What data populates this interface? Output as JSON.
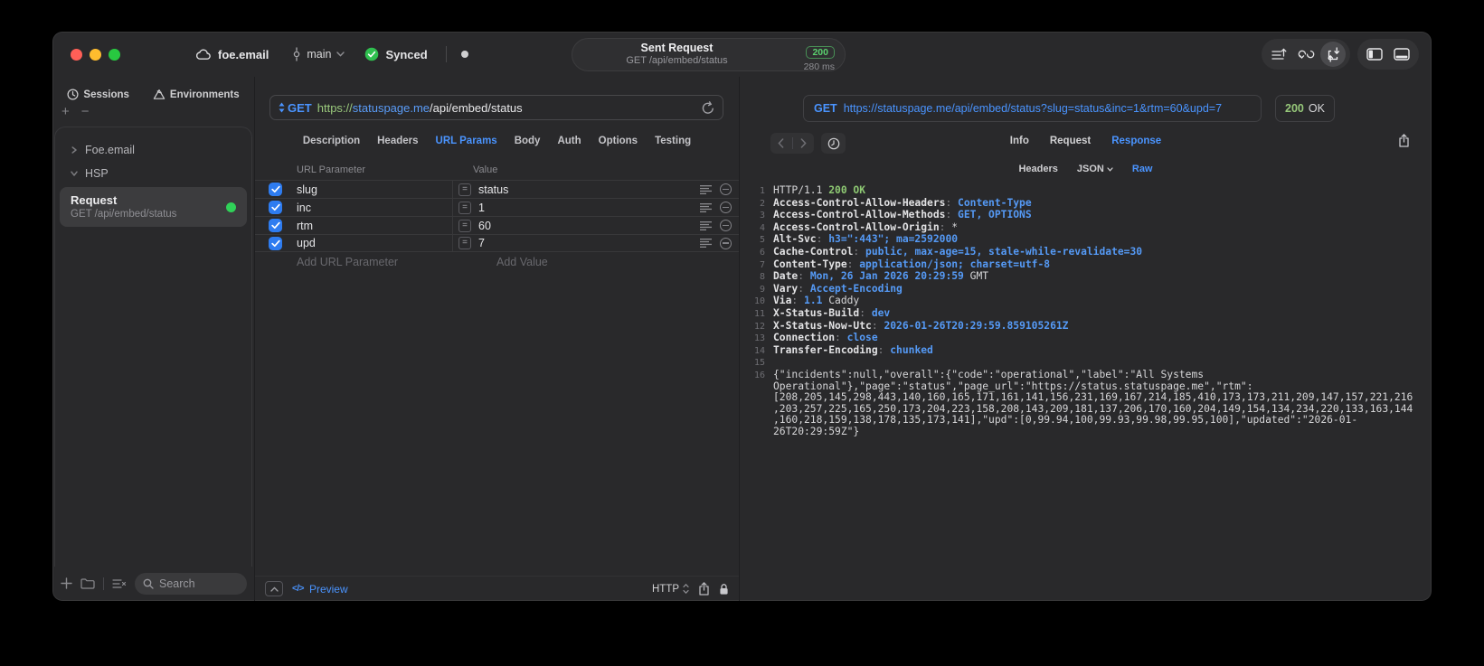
{
  "titlebar": {
    "project": "foe.email",
    "branch": "main",
    "sync_label": "Synced",
    "request_summary": {
      "title": "Sent Request",
      "method_path": "GET /api/embed/status",
      "status_code": "200",
      "duration": "280 ms"
    }
  },
  "sidebar": {
    "tabs": [
      {
        "label": "Sessions"
      },
      {
        "label": "Environments"
      }
    ],
    "tree": [
      {
        "label": "Foe.email",
        "state": "collapsed"
      },
      {
        "label": "HSP",
        "state": "expanded"
      }
    ],
    "request_item": {
      "title": "Request",
      "subtitle": "GET /api/embed/status"
    },
    "search_placeholder": "Search"
  },
  "request_pane": {
    "method": "GET",
    "url_scheme": "https://",
    "url_host": "statuspage.me",
    "url_path": "/api/embed/status",
    "tabs": [
      "Description",
      "Headers",
      "URL Params",
      "Body",
      "Auth",
      "Options",
      "Testing"
    ],
    "active_tab": "URL Params",
    "params_table": {
      "columns": [
        "URL Parameter",
        "Value"
      ],
      "rows": [
        {
          "enabled": true,
          "name": "slug",
          "value": "status"
        },
        {
          "enabled": true,
          "name": "inc",
          "value": "1"
        },
        {
          "enabled": true,
          "name": "rtm",
          "value": "60"
        },
        {
          "enabled": true,
          "name": "upd",
          "value": "7"
        }
      ],
      "add_param_placeholder": "Add URL Parameter",
      "add_value_placeholder": "Add Value"
    },
    "footer": {
      "preview_label": "Preview",
      "code_glyph": "</>",
      "http_label": "HTTP"
    }
  },
  "response_pane": {
    "method": "GET",
    "url": "https://statuspage.me/api/embed/status?slug=status&inc=1&rtm=60&upd=7",
    "status_code": "200",
    "status_text": "OK",
    "tabs": [
      "Info",
      "Request",
      "Response"
    ],
    "active_tab": "Response",
    "subtabs": [
      {
        "label": "Headers",
        "chevron": false
      },
      {
        "label": "JSON",
        "chevron": true
      },
      {
        "label": "Raw",
        "chevron": false
      }
    ],
    "active_subtab": "Raw",
    "lines": [
      {
        "n": 1,
        "segs": [
          [
            "HTTP/1.1 ",
            "plain"
          ],
          [
            "200 OK",
            "green"
          ]
        ]
      },
      {
        "n": 2,
        "segs": [
          [
            "Access-Control-Allow-Headers",
            "name"
          ],
          [
            ": ",
            "punct"
          ],
          [
            "Content-Type",
            "value"
          ]
        ]
      },
      {
        "n": 3,
        "segs": [
          [
            "Access-Control-Allow-Methods",
            "name"
          ],
          [
            ": ",
            "punct"
          ],
          [
            "GET, OPTIONS",
            "value"
          ]
        ]
      },
      {
        "n": 4,
        "segs": [
          [
            "Access-Control-Allow-Origin",
            "name"
          ],
          [
            ": ",
            "punct"
          ],
          [
            "*",
            "plain"
          ]
        ]
      },
      {
        "n": 5,
        "segs": [
          [
            "Alt-Svc",
            "name"
          ],
          [
            ": ",
            "punct"
          ],
          [
            "h3=\":443\"; ma=2592000",
            "value"
          ]
        ]
      },
      {
        "n": 6,
        "segs": [
          [
            "Cache-Control",
            "name"
          ],
          [
            ": ",
            "punct"
          ],
          [
            "public, max-age=15, stale-while-revalidate=30",
            "value"
          ]
        ]
      },
      {
        "n": 7,
        "segs": [
          [
            "Content-Type",
            "name"
          ],
          [
            ": ",
            "punct"
          ],
          [
            "application/json; charset=utf-8",
            "value"
          ]
        ]
      },
      {
        "n": 8,
        "segs": [
          [
            "Date",
            "name"
          ],
          [
            ": ",
            "punct"
          ],
          [
            "Mon, 26 Jan 2026 20:29:59",
            "value"
          ],
          [
            " GMT",
            "plain"
          ]
        ]
      },
      {
        "n": 9,
        "segs": [
          [
            "Vary",
            "name"
          ],
          [
            ": ",
            "punct"
          ],
          [
            "Accept-Encoding",
            "value"
          ]
        ]
      },
      {
        "n": 10,
        "segs": [
          [
            "Via",
            "name"
          ],
          [
            ": ",
            "punct"
          ],
          [
            "1.1",
            "value"
          ],
          [
            " Caddy",
            "plain"
          ]
        ]
      },
      {
        "n": 11,
        "segs": [
          [
            "X-Status-Build",
            "name"
          ],
          [
            ": ",
            "punct"
          ],
          [
            "dev",
            "value"
          ]
        ]
      },
      {
        "n": 12,
        "segs": [
          [
            "X-Status-Now-Utc",
            "name"
          ],
          [
            ": ",
            "punct"
          ],
          [
            "2026-01-26T20:29:59.859105261Z",
            "value"
          ]
        ]
      },
      {
        "n": 13,
        "segs": [
          [
            "Connection",
            "name"
          ],
          [
            ": ",
            "punct"
          ],
          [
            "close",
            "value"
          ]
        ]
      },
      {
        "n": 14,
        "segs": [
          [
            "Transfer-Encoding",
            "name"
          ],
          [
            ": ",
            "punct"
          ],
          [
            "chunked",
            "value"
          ]
        ]
      },
      {
        "n": 15,
        "segs": []
      },
      {
        "n": 16,
        "segs": [
          [
            "{\"incidents\":null,\"overall\":{\"code\":\"operational\",\"label\":\"All Systems Operational\"},\"page\":\"status\",\"page_url\":\"https://status.statuspage.me\",\"rtm\":[208,205,145,298,443,140,160,165,171,161,141,156,231,169,167,214,185,410,173,173,211,209,147,157,221,216,203,257,225,165,250,173,204,223,158,208,143,209,181,137,206,170,160,204,149,154,134,234,220,133,163,144,160,218,159,138,178,135,173,141],\"upd\":[0,99.94,100,99.93,99.98,99.95,100],\"updated\":\"2026-01-26T20:29:59Z\"}",
            "plain"
          ]
        ]
      }
    ]
  },
  "colors": {
    "accent_blue": "#4a94ff",
    "success_green": "#30d158",
    "status_green": "#97c97a",
    "scheme_green": "#9ac97c",
    "checkbox_blue": "#2e7cf0",
    "window_bg": "#29292b"
  }
}
